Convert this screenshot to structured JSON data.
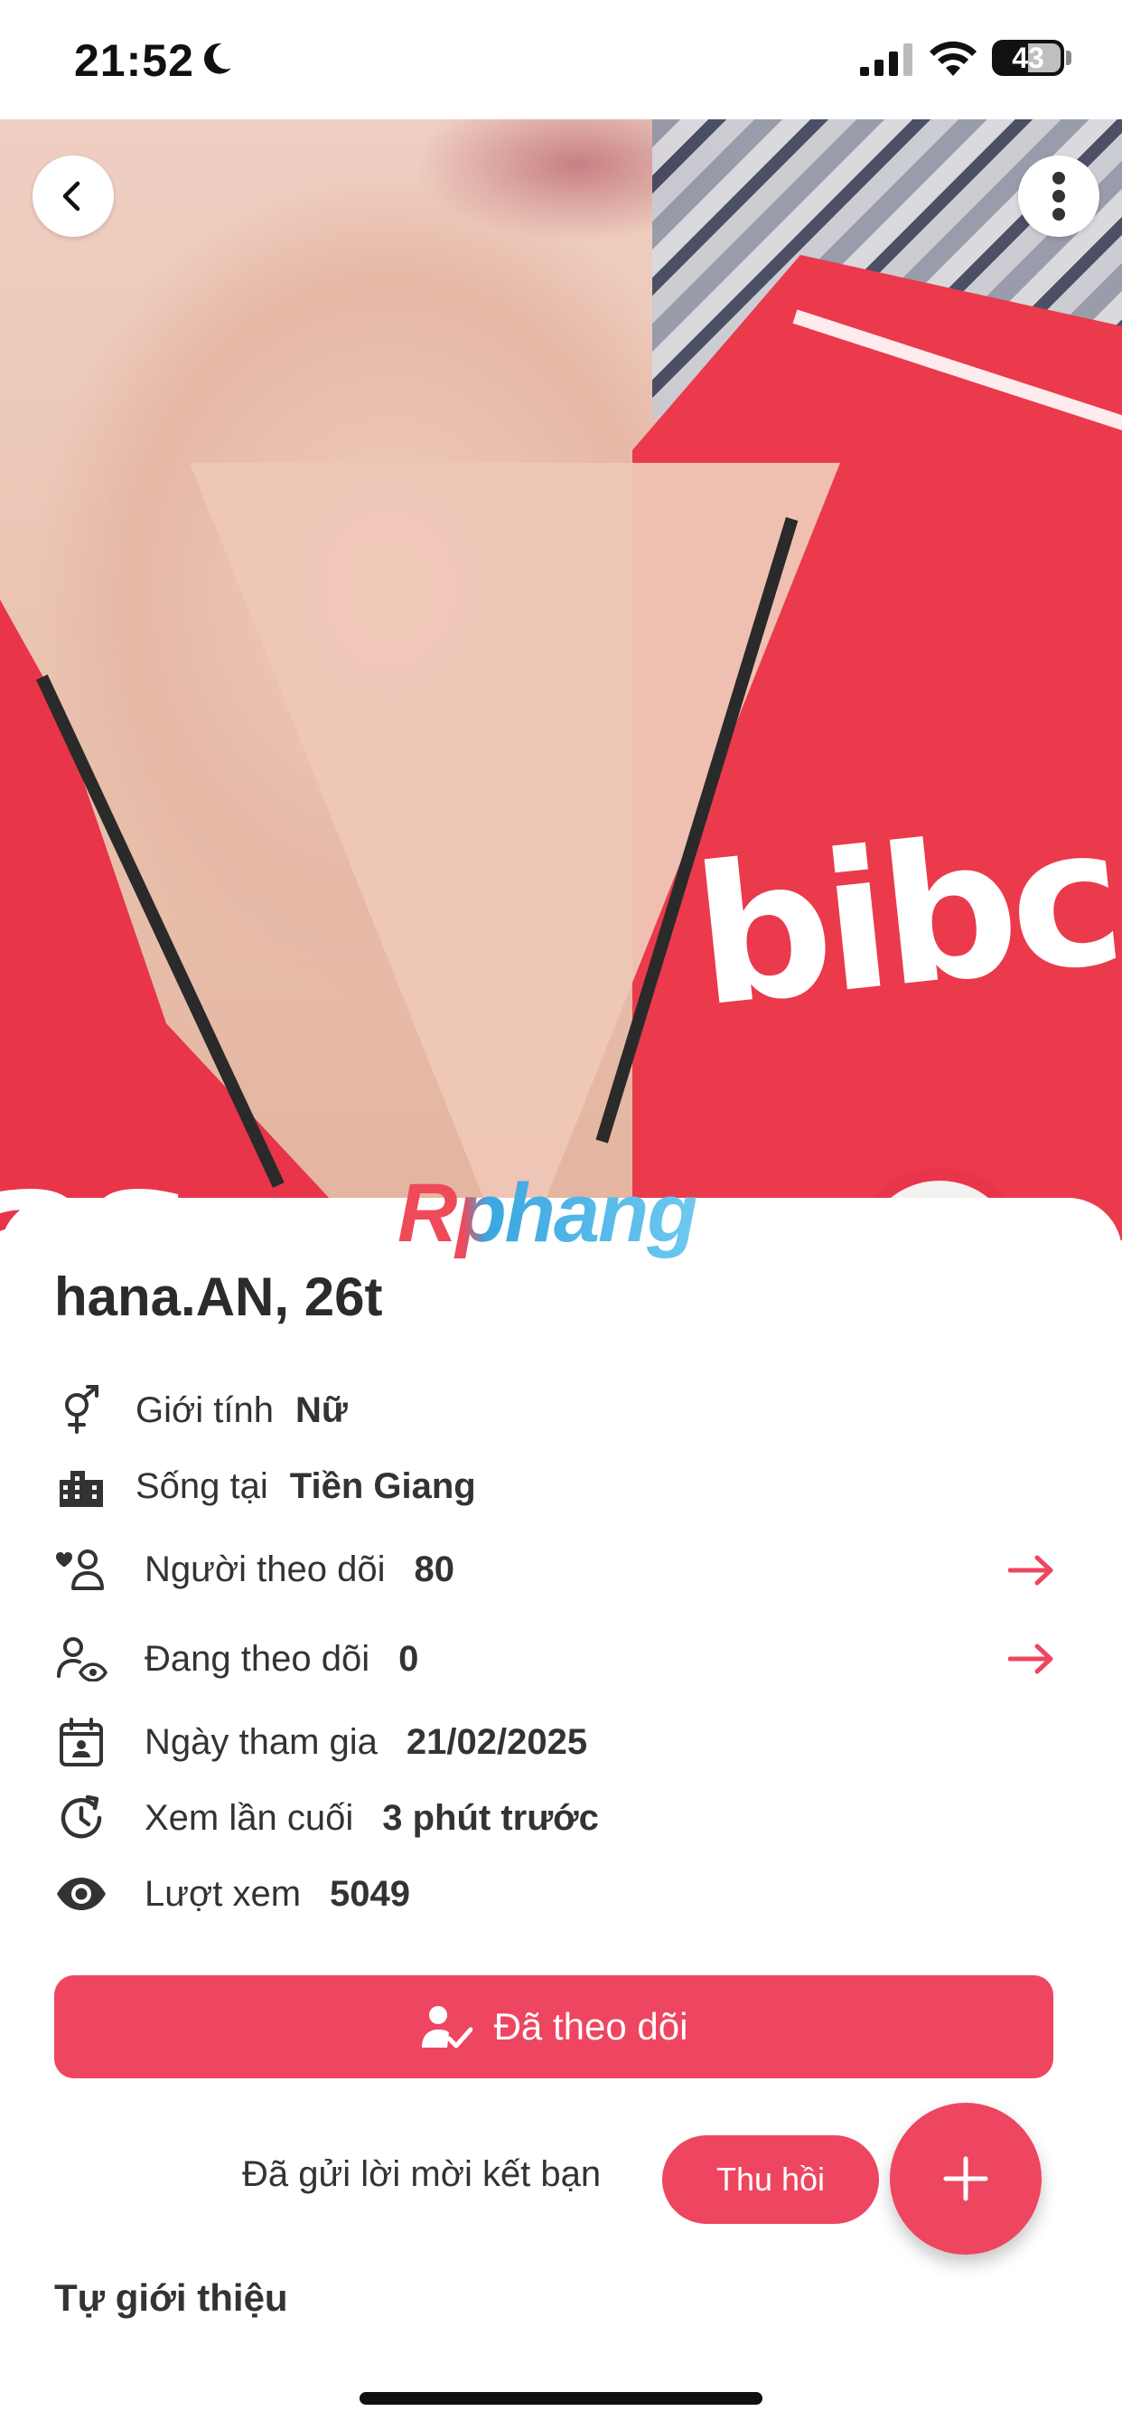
{
  "status_bar": {
    "time": "21:52",
    "battery_level": "43"
  },
  "watermark": "Rphang",
  "shirt_prints": {
    "main": "bibc",
    "left": "as"
  },
  "profile": {
    "name_age": "hana.AN, 26t",
    "rows": [
      {
        "icon": "gender-icon",
        "label": "Giới tính",
        "value": "Nữ"
      },
      {
        "icon": "city-icon",
        "label": "Sống tại",
        "value": "Tiền Giang"
      },
      {
        "icon": "followers-icon",
        "label": "Người theo dõi",
        "value": "80"
      },
      {
        "icon": "following-icon",
        "label": "Đang theo dõi",
        "value": "0"
      },
      {
        "icon": "calendar-icon",
        "label": "Ngày tham gia",
        "value": "21/02/2025"
      },
      {
        "icon": "history-icon",
        "label": "Xem lần cuối",
        "value": "3 phút trước"
      },
      {
        "icon": "eye-icon",
        "label": "Lượt xem",
        "value": "5049"
      }
    ]
  },
  "actions": {
    "follow_label": "Đã theo dõi",
    "friend_request_text": "Đã gửi lời mời kết bạn",
    "revoke_label": "Thu hồi"
  },
  "sections": {
    "about_title": "Tự giới thiệu"
  },
  "colors": {
    "accent": "#EE4660",
    "text": "#333333"
  }
}
